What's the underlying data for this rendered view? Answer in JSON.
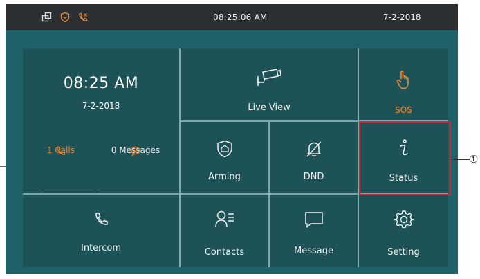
{
  "status_bar": {
    "icons": [
      "multi-window-icon",
      "shield-icon",
      "phone-call-icon"
    ],
    "time": "08:25:06   AM",
    "date": "7-2-2018"
  },
  "clock_panel": {
    "time": "08:25 AM",
    "date": "7-2-2018",
    "calls_label": "1 Calls",
    "messages_label": "0 Messages"
  },
  "tiles": {
    "live_view": "Live View",
    "sos": "SOS",
    "arming": "Arming",
    "dnd": "DND",
    "status": "Status",
    "intercom": "Intercom",
    "contacts": "Contacts",
    "message": "Message",
    "setting": "Setting"
  },
  "callout": {
    "number": "①"
  },
  "colors": {
    "accent_orange": "#e8883a",
    "tile_bg": "#1d5257",
    "highlight_red": "#d72533"
  }
}
